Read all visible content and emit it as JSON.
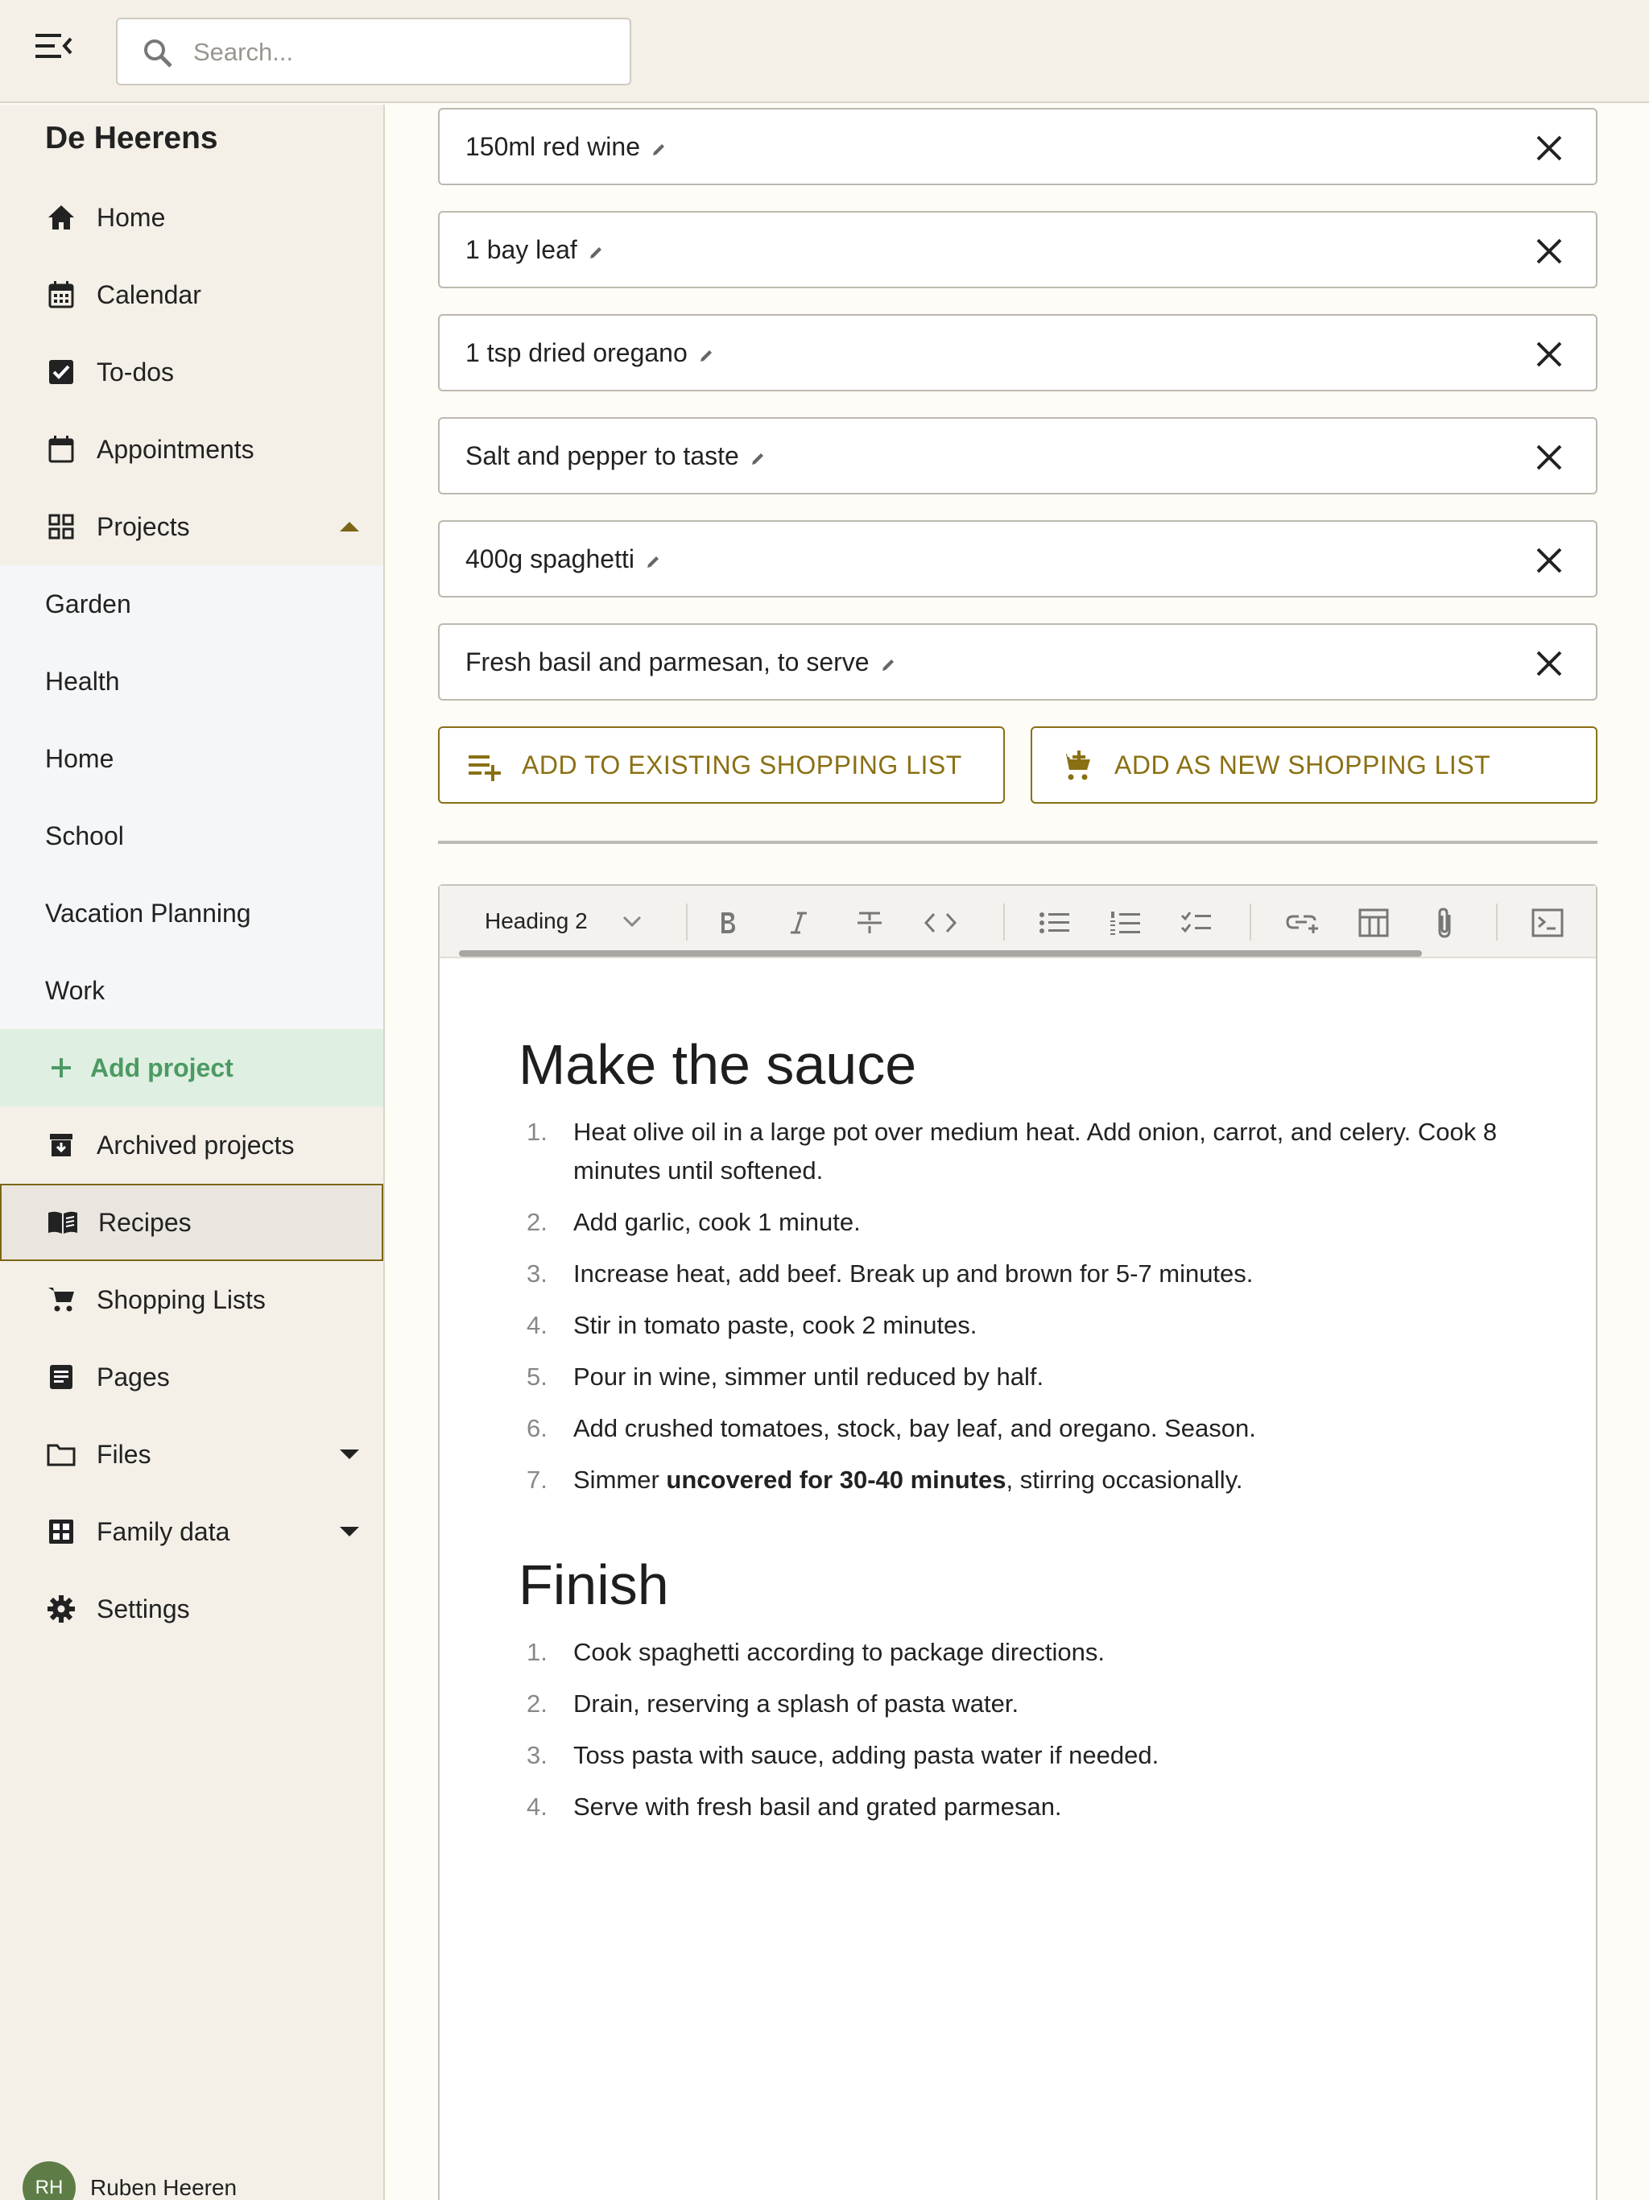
{
  "search": {
    "placeholder": "Search..."
  },
  "sidebar": {
    "family_name": "De Heerens",
    "items": [
      {
        "label": "Home",
        "icon": "home-icon"
      },
      {
        "label": "Calendar",
        "icon": "calendar-icon"
      },
      {
        "label": "To-dos",
        "icon": "checkbox-icon"
      },
      {
        "label": "Appointments",
        "icon": "calendar-blank-icon"
      },
      {
        "label": "Projects",
        "icon": "grid-icon"
      }
    ],
    "projects": [
      "Garden",
      "Health",
      "Home",
      "School",
      "Vacation Planning",
      "Work"
    ],
    "add_project": "Add project",
    "items_after": [
      {
        "label": "Archived projects",
        "icon": "archive-icon"
      },
      {
        "label": "Recipes",
        "icon": "book-icon"
      },
      {
        "label": "Shopping Lists",
        "icon": "cart-icon"
      },
      {
        "label": "Pages",
        "icon": "page-icon"
      },
      {
        "label": "Files",
        "icon": "folder-icon"
      },
      {
        "label": "Family data",
        "icon": "table-icon"
      },
      {
        "label": "Settings",
        "icon": "gear-icon"
      }
    ],
    "active_item": "Recipes"
  },
  "user": {
    "initials": "RH",
    "name": "Ruben Heeren"
  },
  "ingredients": [
    "150ml red wine",
    "1 bay leaf",
    "1 tsp dried oregano",
    "Salt and pepper to taste",
    "400g spaghetti",
    "Fresh basil and parmesan, to serve"
  ],
  "buttons": {
    "add_existing": "ADD TO EXISTING SHOPPING LIST",
    "add_new": "ADD AS NEW SHOPPING LIST"
  },
  "toolbar": {
    "block_type": "Heading 2"
  },
  "editor": {
    "section1": {
      "heading": "Make the sauce",
      "steps": [
        {
          "n": "1.",
          "text": "Heat olive oil in a large pot over medium heat. Add onion, carrot, and celery. Cook 8 minutes until softened."
        },
        {
          "n": "2.",
          "text": "Add garlic, cook 1 minute."
        },
        {
          "n": "3.",
          "text": "Increase heat, add beef. Break up and brown for 5-7 minutes."
        },
        {
          "n": "4.",
          "text": "Stir in tomato paste, cook 2 minutes."
        },
        {
          "n": "5.",
          "text": "Pour in wine, simmer until reduced by half."
        },
        {
          "n": "6.",
          "text": "Add crushed tomatoes, stock, bay leaf, and oregano. Season."
        },
        {
          "n": "7.",
          "pre": "Simmer ",
          "bold": "uncovered for 30-40 minutes",
          "post": ", stirring occasionally."
        }
      ]
    },
    "section2": {
      "heading": "Finish",
      "steps": [
        {
          "n": "1.",
          "text": "Cook spaghetti according to package directions."
        },
        {
          "n": "2.",
          "text": "Drain, reserving a splash of pasta water."
        },
        {
          "n": "3.",
          "text": "Toss pasta with sauce, adding pasta water if needed."
        },
        {
          "n": "4.",
          "text": "Serve with fresh basil and grated parmesan."
        }
      ]
    }
  },
  "colors": {
    "accent": "#8a7014",
    "green": "#4c9a63",
    "sidebar_bg": "#f4f0e8"
  }
}
